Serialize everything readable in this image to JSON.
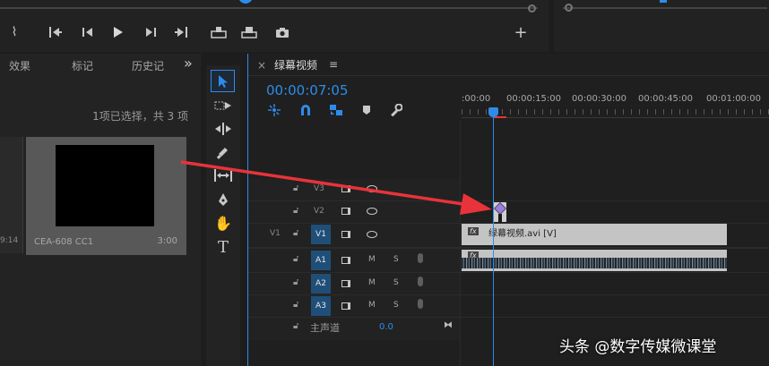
{
  "transport": {
    "mark_in_glyph": "⌇",
    "add_label": "+"
  },
  "project_panel": {
    "tabs": [
      "效果",
      "标记",
      "历史记"
    ],
    "more_glyph": "»",
    "selection_status": "1项已选择，共 3 项",
    "left_item_duration": "9:14",
    "clip_name": "CEA-608 CC1",
    "clip_duration": "3:00"
  },
  "sequence": {
    "close_glyph": "×",
    "name": "绿幕视频",
    "menu_glyph": "≡",
    "timecode": "00:00:07:05",
    "ruler_ticks": [
      ":00:00",
      "00:00:15:00",
      "00:00:30:00",
      "00:00:45:00",
      "00:01:00:00"
    ]
  },
  "tracks": {
    "video": [
      {
        "name": "V3",
        "source": ""
      },
      {
        "name": "V2",
        "source": ""
      },
      {
        "name": "V1",
        "source": "V1"
      }
    ],
    "audio": [
      {
        "name": "A1",
        "m": "M",
        "s": "S"
      },
      {
        "name": "A2",
        "m": "M",
        "s": "S"
      },
      {
        "name": "A3",
        "m": "M",
        "s": "S"
      }
    ],
    "master_label": "主声道",
    "master_value": "0.0"
  },
  "clips": {
    "video_fx": "fx",
    "video_clip_name": "绿幕视频.avi [V]",
    "audio_fx": "fx"
  },
  "watermark": "头条 @数字传媒微课堂",
  "colors": {
    "accent_blue": "#2d8ceb",
    "arrow_red": "#e8333a",
    "panel_bg": "#232323",
    "clip_gray": "#c4c4c4",
    "track_on": "#1f4f79"
  }
}
